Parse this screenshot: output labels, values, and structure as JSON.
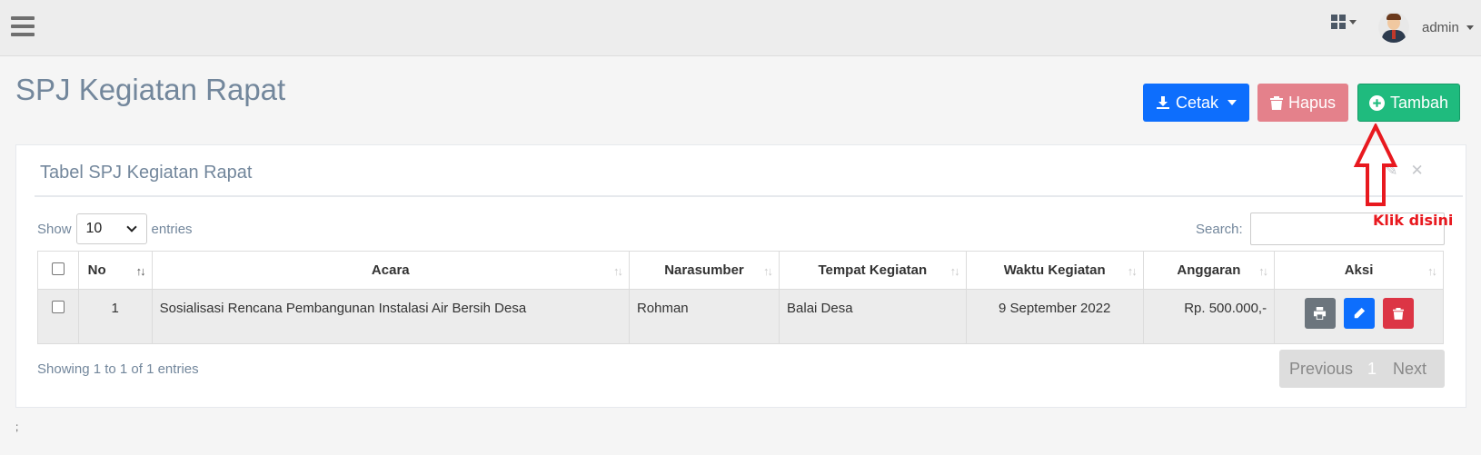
{
  "header": {
    "apps_icon": "grid-icon",
    "user_name": "admin"
  },
  "page": {
    "title": "SPJ Kegiatan Rapat"
  },
  "actions": {
    "cetak_label": "Cetak",
    "hapus_label": "Hapus",
    "tambah_label": "Tambah"
  },
  "panel": {
    "title": "Tabel SPJ Kegiatan Rapat"
  },
  "datatable": {
    "show_label": "Show",
    "entries_value": "10",
    "entries_label": "entries",
    "search_label": "Search:",
    "search_value": "",
    "columns": [
      "No",
      "Acara",
      "Narasumber",
      "Tempat Kegiatan",
      "Waktu Kegiatan",
      "Anggaran",
      "Aksi"
    ],
    "rows": [
      {
        "no": "1",
        "acara": "Sosialisasi Rencana Pembangunan Instalasi Air Bersih Desa",
        "narasumber": "Rohman",
        "tempat": "Balai Desa",
        "waktu": "9 September 2022",
        "anggaran": "Rp. 500.000,-"
      }
    ],
    "info": "Showing 1 to 1 of 1 entries",
    "pagination": {
      "previous": "Previous",
      "current": "1",
      "next": "Next"
    }
  },
  "footer": {
    "text": ";"
  },
  "annotation": {
    "label": "Klik disini",
    "color": "#e8191f"
  },
  "colors": {
    "primary": "#0d6efd",
    "danger_light": "#e4818b",
    "success": "#1fbb7e",
    "title": "#73879c"
  }
}
